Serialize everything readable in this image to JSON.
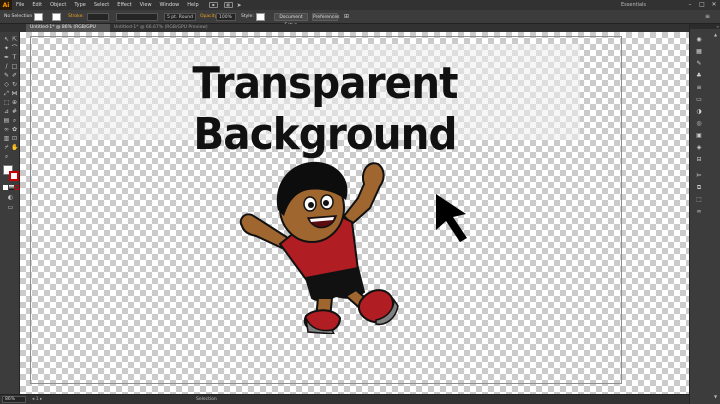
{
  "app": {
    "logo": "Ai",
    "workspace": "Essentials"
  },
  "menu": [
    "File",
    "Edit",
    "Object",
    "Type",
    "Select",
    "Effect",
    "View",
    "Window",
    "Help"
  ],
  "control": {
    "selection": "No Selection",
    "stroke_label": "Stroke:",
    "stroke_value": "",
    "brush": "5 pt. Round",
    "opacity_label": "Opacity:",
    "opacity_value": "100%",
    "style_label": "Style:",
    "doc_setup": "Document Setup",
    "preferences": "Preferences"
  },
  "tabs": [
    {
      "label": "Untitled-1* @ 86% (RGB/GPU Preview)",
      "active": true
    },
    {
      "label": "Untitled-1* @ 66.67% (RGB/GPU Preview)",
      "active": false
    }
  ],
  "artboard": {
    "headline": "Transparent Background"
  },
  "status": {
    "zoom": "86%",
    "tool": "Selection"
  },
  "colors": {
    "accent": "#ff9a00",
    "shirt": "#b01d22",
    "skin": "#a0662f",
    "hair": "#0d0d0d"
  },
  "icons": {
    "toolbar": [
      "selection-icon",
      "direct-select-icon",
      "magic-wand-icon",
      "lasso-icon",
      "pen-icon",
      "type-icon",
      "line-icon",
      "rectangle-icon",
      "paintbrush-icon",
      "pencil-icon",
      "eraser-icon",
      "rotate-icon",
      "scale-icon",
      "width-icon",
      "free-transform-icon",
      "shape-builder-icon",
      "perspective-icon",
      "mesh-icon",
      "gradient-icon",
      "eyedropper-icon",
      "blend-icon",
      "symbol-sprayer-icon",
      "graph-icon",
      "artboard-icon",
      "slice-icon",
      "hand-icon",
      "zoom-icon"
    ],
    "dock": [
      "color-panel-icon",
      "swatches-icon",
      "brushes-icon",
      "symbols-icon",
      "stroke-icon",
      "gradient-panel-icon",
      "transparency-icon",
      "appearance-icon",
      "graphic-styles-icon",
      "layers-icon",
      "artboards-icon",
      "align-icon",
      "pathfinder-icon",
      "transform-icon",
      "links-icon"
    ]
  }
}
